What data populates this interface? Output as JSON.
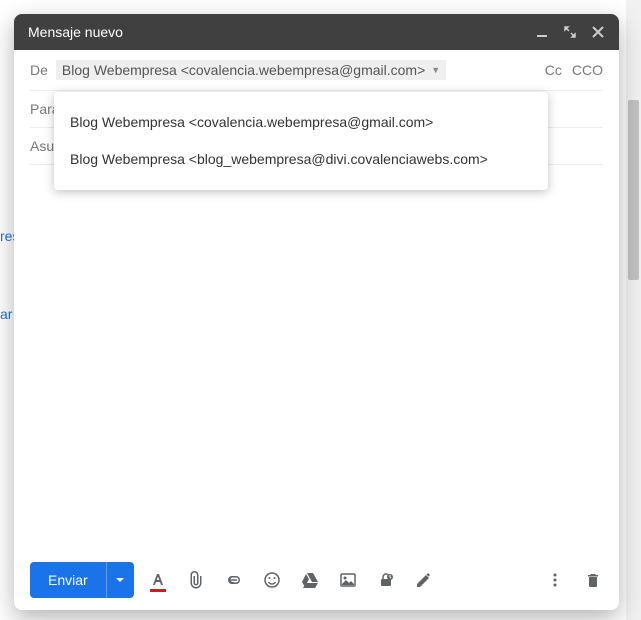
{
  "header": {
    "title": "Mensaje nuevo"
  },
  "from": {
    "label": "De",
    "value": "Blog Webempresa <covalencia.webempresa@gmail.com>"
  },
  "to": {
    "label": "Para"
  },
  "subject": {
    "label": "Asu"
  },
  "cc": "Cc",
  "bcc": "CCO",
  "dropdown": {
    "item1": "Blog Webempresa <covalencia.webempresa@gmail.com>",
    "item2": "Blog Webempresa <blog_webempresa@divi.covalenciawebs.com>"
  },
  "footer": {
    "send": "Enviar"
  },
  "side": {
    "t1": "res",
    "t2": "ar s"
  }
}
